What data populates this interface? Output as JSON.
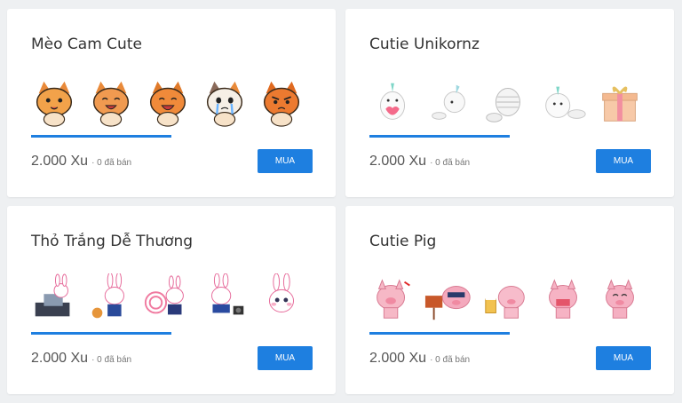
{
  "packs": [
    {
      "title": "Mèo Cam Cute",
      "price": "2.000 Xu",
      "sold": "· 0 đã bán",
      "button": "MUA",
      "theme": "cat",
      "colors": [
        "#f2a24a",
        "#e98a3a",
        "#f09040",
        "#e8a070",
        "#ec7a30"
      ]
    },
    {
      "title": "Cutie Unikornz",
      "price": "2.000 Xu",
      "sold": "· 0 đã bán",
      "button": "MUA",
      "theme": "unicorn",
      "colors": [
        "#f7f3f6",
        "#f2f2f2",
        "#f4f4f4",
        "#f6f2f4",
        "#f2c99a"
      ]
    },
    {
      "title": "Thỏ Trắng Dễ Thương",
      "price": "2.000 Xu",
      "sold": "· 0 đã bán",
      "button": "MUA",
      "theme": "rabbit",
      "colors": [
        "#ffffff",
        "#ffffff",
        "#ffffff",
        "#ffffff",
        "#ffffff"
      ]
    },
    {
      "title": "Cutie Pig",
      "price": "2.000 Xu",
      "sold": "· 0 đã bán",
      "button": "MUA",
      "theme": "pig",
      "colors": [
        "#f6b8c6",
        "#f4a9bd",
        "#f7bccb",
        "#f6b3c4",
        "#f5b0c2"
      ]
    }
  ]
}
